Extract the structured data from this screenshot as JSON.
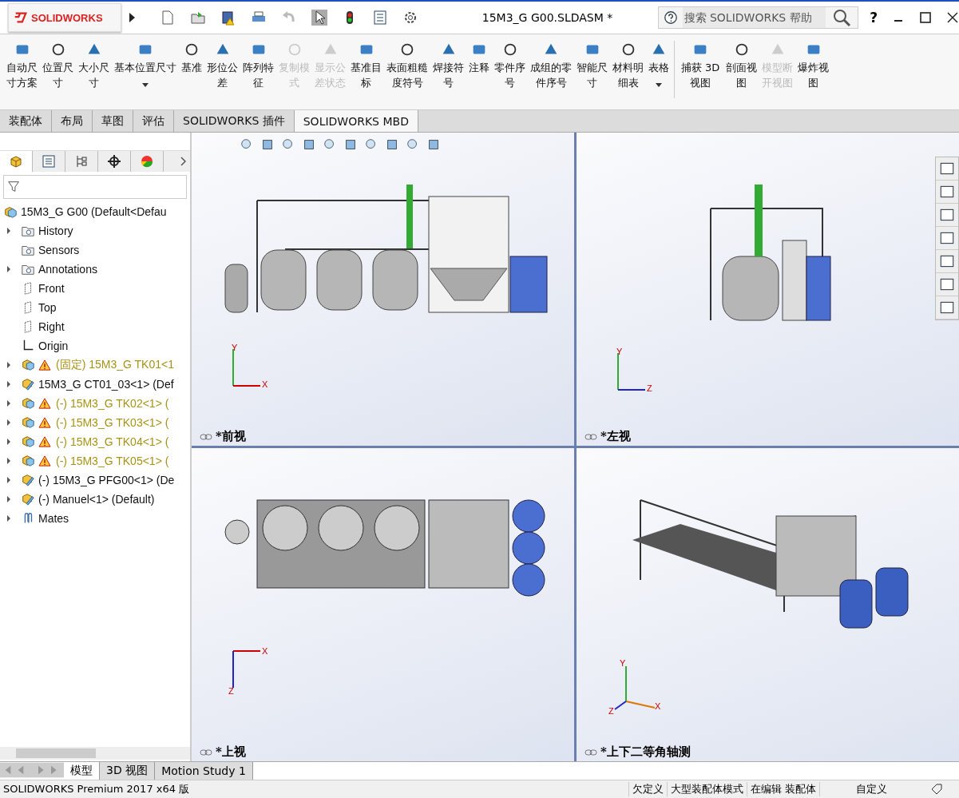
{
  "title_bar": {
    "logo_text": "SOLIDWORKS",
    "file_title": "15M3_G G00.SLDASM *",
    "search_placeholder": "搜索 SOLIDWORKS 帮助",
    "help": "?"
  },
  "ribbon": [
    {
      "label": "自动尺寸方案",
      "disabled": false,
      "dropdown": false
    },
    {
      "label": "位置尺寸",
      "disabled": false,
      "dropdown": false
    },
    {
      "label": "大小尺寸",
      "disabled": false,
      "dropdown": false
    },
    {
      "label": "基本位置尺寸",
      "disabled": false,
      "dropdown": true
    },
    {
      "label": "基准",
      "disabled": false,
      "dropdown": false
    },
    {
      "label": "形位公差",
      "disabled": false,
      "dropdown": false
    },
    {
      "label": "阵列特征",
      "disabled": false,
      "dropdown": false
    },
    {
      "label": "复制模式",
      "disabled": true,
      "dropdown": false
    },
    {
      "label": "显示公差状态",
      "disabled": true,
      "dropdown": false
    },
    {
      "label": "基准目标",
      "disabled": false,
      "dropdown": false
    },
    {
      "label": "表面粗糙度符号",
      "disabled": false,
      "dropdown": false
    },
    {
      "label": "焊接符号",
      "disabled": false,
      "dropdown": false
    },
    {
      "label": "注释",
      "disabled": false,
      "dropdown": false
    },
    {
      "label": "零件序号",
      "disabled": false,
      "dropdown": false
    },
    {
      "label": "成组的零件序号",
      "disabled": false,
      "dropdown": false
    },
    {
      "label": "智能尺寸",
      "disabled": false,
      "dropdown": false
    },
    {
      "label": "材料明细表",
      "disabled": false,
      "dropdown": false
    },
    {
      "label": "表格",
      "disabled": false,
      "dropdown": true
    },
    {
      "label": "捕获 3D视图",
      "disabled": false,
      "dropdown": false
    },
    {
      "label": "剖面视图",
      "disabled": false,
      "dropdown": false
    },
    {
      "label": "模型断开视图",
      "disabled": true,
      "dropdown": false
    },
    {
      "label": "爆炸视图",
      "disabled": false,
      "dropdown": false
    }
  ],
  "command_tabs": [
    {
      "label": "装配体",
      "selected": false
    },
    {
      "label": "布局",
      "selected": false
    },
    {
      "label": "草图",
      "selected": false
    },
    {
      "label": "评估",
      "selected": false
    },
    {
      "label": "SOLIDWORKS 插件",
      "selected": false
    },
    {
      "label": "SOLIDWORKS MBD",
      "selected": true
    }
  ],
  "tree": {
    "root": "15M3_G G00  (Default<Defau",
    "items": [
      {
        "kind": "folder",
        "label": "History",
        "expandable": true,
        "warning": false
      },
      {
        "kind": "folder",
        "label": "Sensors",
        "expandable": false,
        "warning": false
      },
      {
        "kind": "folder",
        "label": "Annotations",
        "expandable": true,
        "warning": false
      },
      {
        "kind": "plane",
        "label": "Front",
        "expandable": false,
        "warning": false
      },
      {
        "kind": "plane",
        "label": "Top",
        "expandable": false,
        "warning": false
      },
      {
        "kind": "plane",
        "label": "Right",
        "expandable": false,
        "warning": false
      },
      {
        "kind": "origin",
        "label": "Origin",
        "expandable": false,
        "warning": false
      },
      {
        "kind": "part",
        "label": "(固定) 15M3_G TK01<1",
        "expandable": true,
        "warning": true
      },
      {
        "kind": "subassembly",
        "label": "15M3_G CT01_03<1> (Def",
        "expandable": true,
        "warning": false
      },
      {
        "kind": "part",
        "label": "(-) 15M3_G TK02<1> (",
        "expandable": true,
        "warning": true
      },
      {
        "kind": "part",
        "label": "(-) 15M3_G TK03<1> (",
        "expandable": true,
        "warning": true
      },
      {
        "kind": "part",
        "label": "(-) 15M3_G TK04<1> (",
        "expandable": true,
        "warning": true
      },
      {
        "kind": "part",
        "label": "(-) 15M3_G TK05<1> (",
        "expandable": true,
        "warning": true
      },
      {
        "kind": "subassembly",
        "label": "(-) 15M3_G PFG00<1> (De",
        "expandable": true,
        "warning": false
      },
      {
        "kind": "subassembly",
        "label": "(-) Manuel<1> (Default)",
        "expandable": true,
        "warning": false
      },
      {
        "kind": "mates",
        "label": "Mates",
        "expandable": true,
        "warning": false
      }
    ]
  },
  "viewports": [
    {
      "kind": "front",
      "label": "*前视",
      "axes": [
        "Y",
        "X"
      ]
    },
    {
      "kind": "left",
      "label": "*左视",
      "axes": [
        "Y",
        "Z"
      ]
    },
    {
      "kind": "top",
      "label": "*上视",
      "axes": [
        "X",
        "Z"
      ]
    },
    {
      "kind": "iso",
      "label": "*上下二等角轴测",
      "axes": [
        "Y",
        "X",
        "Z"
      ]
    }
  ],
  "bottom_tabs": [
    {
      "label": "模型",
      "selected": true
    },
    {
      "label": "3D 视图",
      "selected": false
    },
    {
      "label": "Motion Study 1",
      "selected": false
    }
  ],
  "status_bar": {
    "product": "SOLIDWORKS Premium 2017 x64 版",
    "fields": [
      "欠定义",
      "大型装配体模式",
      "在编辑 装配体",
      "自定义"
    ]
  }
}
